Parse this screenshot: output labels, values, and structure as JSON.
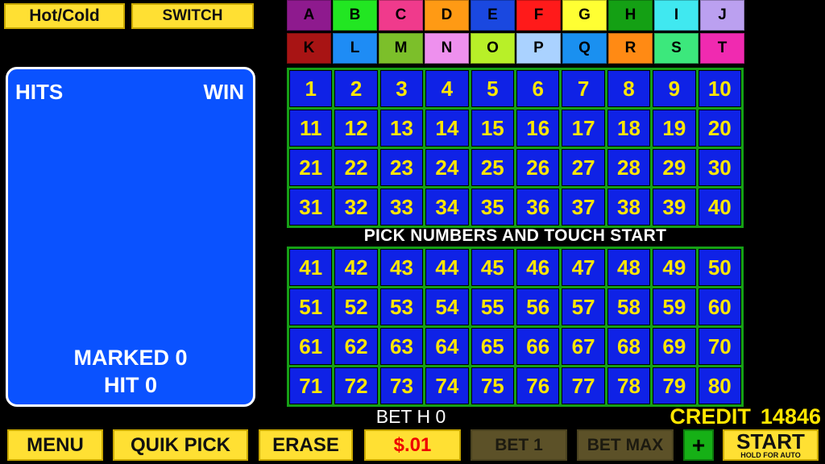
{
  "top_buttons": {
    "hotcold": "Hot/Cold",
    "switch": "SWITCH"
  },
  "letters": [
    {
      "label": "A",
      "color": "#8e1a8e"
    },
    {
      "label": "B",
      "color": "#22e622"
    },
    {
      "label": "C",
      "color": "#f03a8c"
    },
    {
      "label": "D",
      "color": "#ff9a14"
    },
    {
      "label": "E",
      "color": "#1a48e0"
    },
    {
      "label": "F",
      "color": "#ff1a1a"
    },
    {
      "label": "G",
      "color": "#ffff33"
    },
    {
      "label": "H",
      "color": "#14a014"
    },
    {
      "label": "I",
      "color": "#40e8f0"
    },
    {
      "label": "J",
      "color": "#bba0f0"
    },
    {
      "label": "K",
      "color": "#a81414"
    },
    {
      "label": "L",
      "color": "#1e8cf5"
    },
    {
      "label": "M",
      "color": "#7cbf2a"
    },
    {
      "label": "N",
      "color": "#ee90ee"
    },
    {
      "label": "O",
      "color": "#b8f028"
    },
    {
      "label": "P",
      "color": "#aad2ff"
    },
    {
      "label": "Q",
      "color": "#1a90f0"
    },
    {
      "label": "R",
      "color": "#ff8a14"
    },
    {
      "label": "S",
      "color": "#3ce87c"
    },
    {
      "label": "T",
      "color": "#f02ab0"
    }
  ],
  "panel": {
    "hits_label": "HITS",
    "win_label": "WIN",
    "marked_text": "MARKED 0",
    "hit_text": "HIT 0"
  },
  "numbers_top": [
    1,
    2,
    3,
    4,
    5,
    6,
    7,
    8,
    9,
    10,
    11,
    12,
    13,
    14,
    15,
    16,
    17,
    18,
    19,
    20,
    21,
    22,
    23,
    24,
    25,
    26,
    27,
    28,
    29,
    30,
    31,
    32,
    33,
    34,
    35,
    36,
    37,
    38,
    39,
    40
  ],
  "numbers_bottom": [
    41,
    42,
    43,
    44,
    45,
    46,
    47,
    48,
    49,
    50,
    51,
    52,
    53,
    54,
    55,
    56,
    57,
    58,
    59,
    60,
    61,
    62,
    63,
    64,
    65,
    66,
    67,
    68,
    69,
    70,
    71,
    72,
    73,
    74,
    75,
    76,
    77,
    78,
    79,
    80
  ],
  "instruction": "PICK NUMBERS AND TOUCH START",
  "bet_text": "BET H 0",
  "credit": {
    "label": "CREDIT",
    "value": "14846"
  },
  "bottom_buttons": {
    "menu": "MENU",
    "quik_pick": "QUIK PICK",
    "erase": "ERASE",
    "denom": "$.01",
    "bet1": "BET 1",
    "betmax": "BET MAX",
    "plus": "+",
    "start": "START",
    "start_sub": "HOLD FOR AUTO"
  }
}
